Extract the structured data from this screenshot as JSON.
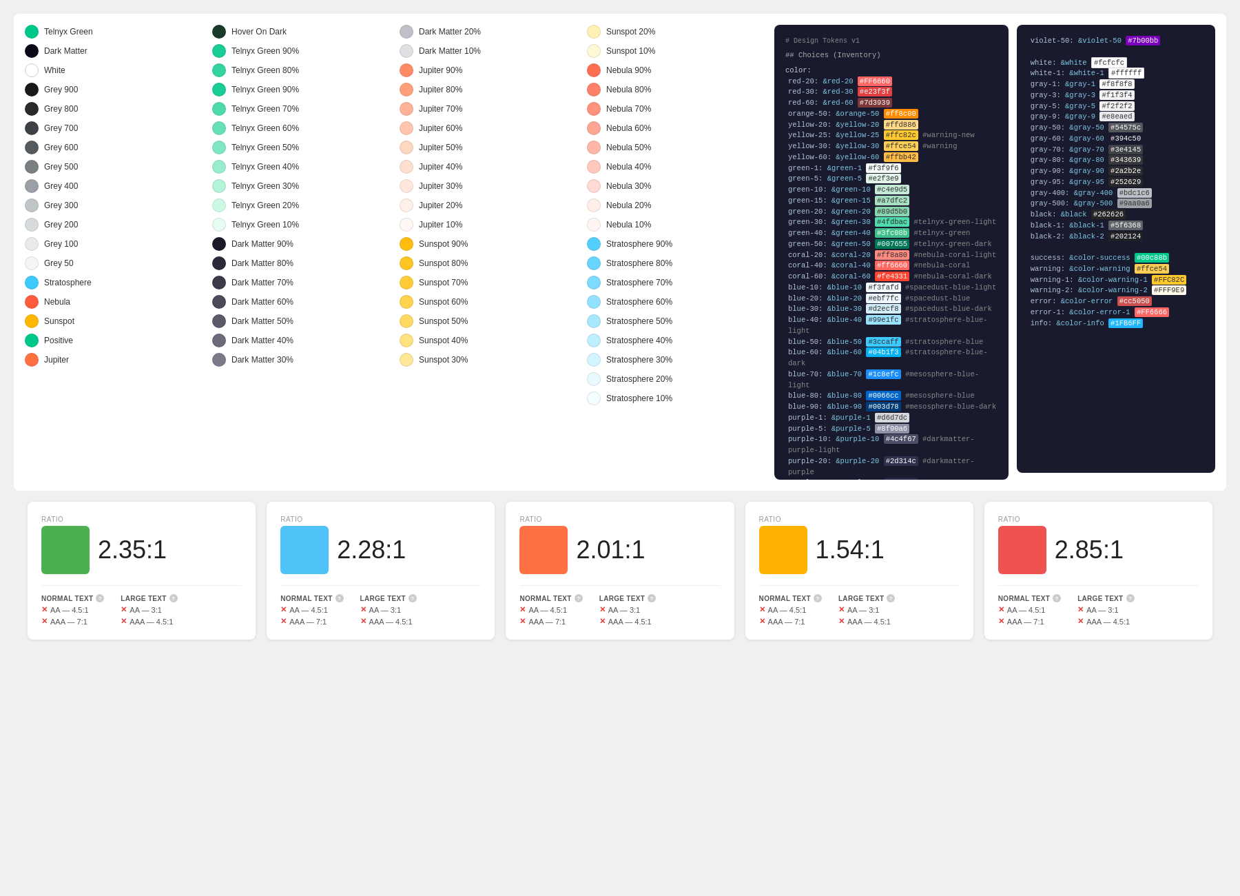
{
  "swatches": {
    "columns": [
      {
        "items": [
          {
            "label": "Telnyx Green",
            "color": "#00c88b",
            "type": "filled"
          },
          {
            "label": "Dark Matter",
            "color": "#0a0a1a",
            "type": "filled"
          },
          {
            "label": "White",
            "color": "#ffffff",
            "type": "outline"
          },
          {
            "label": "Grey 900",
            "color": "#1a1a1a",
            "type": "filled"
          },
          {
            "label": "Grey 800",
            "color": "#2a2a2a",
            "type": "filled"
          },
          {
            "label": "Grey 700",
            "color": "#3e4145",
            "type": "filled"
          },
          {
            "label": "Grey 600",
            "color": "#555a5e",
            "type": "filled"
          },
          {
            "label": "Grey 500",
            "color": "#7a8082",
            "type": "filled"
          },
          {
            "label": "Grey 400",
            "color": "#9aa0a6",
            "type": "filled"
          },
          {
            "label": "Grey 300",
            "color": "#c0c5c8",
            "type": "filled"
          },
          {
            "label": "Grey 200",
            "color": "#d8dbdd",
            "type": "filled"
          },
          {
            "label": "Grey 100",
            "color": "#e8eaeb",
            "type": "filled"
          },
          {
            "label": "Grey 50",
            "color": "#f4f5f5",
            "type": "filled"
          },
          {
            "label": "Stratosphere",
            "color": "#3ccaff",
            "type": "filled"
          },
          {
            "label": "Nebula",
            "color": "#ff5c3d",
            "type": "filled"
          },
          {
            "label": "Sunspot",
            "color": "#ffb700",
            "type": "filled"
          },
          {
            "label": "Positive",
            "color": "#00c88b",
            "type": "filled"
          },
          {
            "label": "Jupiter",
            "color": "#ff7043",
            "type": "filled"
          }
        ]
      },
      {
        "items": [
          {
            "label": "Hover On Dark",
            "color": "#1a3a2a",
            "type": "filled"
          },
          {
            "label": "Telnyx Green 90%",
            "color": "#1acd96",
            "type": "filled"
          },
          {
            "label": "Telnyx Green 80%",
            "color": "#33d3a1",
            "type": "filled"
          },
          {
            "label": "Telnyx Green 90%",
            "color": "#1acd96",
            "type": "filled"
          },
          {
            "label": "Telnyx Green 70%",
            "color": "#4ddaac",
            "type": "filled"
          },
          {
            "label": "Telnyx Green 60%",
            "color": "#66e0b7",
            "type": "filled"
          },
          {
            "label": "Telnyx Green 50%",
            "color": "#80e7c2",
            "type": "filled"
          },
          {
            "label": "Telnyx Green 40%",
            "color": "#99edcd",
            "type": "filled"
          },
          {
            "label": "Telnyx Green 30%",
            "color": "#b3f3d8",
            "type": "filled"
          },
          {
            "label": "Telnyx Green 20%",
            "color": "#ccf9e3",
            "type": "filled"
          },
          {
            "label": "Telnyx Green 10%",
            "color": "#e6fcf1",
            "type": "filled"
          },
          {
            "label": "Dark Matter 90%",
            "color": "#1a1a2a",
            "type": "filled"
          },
          {
            "label": "Dark Matter 80%",
            "color": "#2a2a3a",
            "type": "filled"
          },
          {
            "label": "Dark Matter 70%",
            "color": "#3a3a4a",
            "type": "filled"
          },
          {
            "label": "Dark Matter 60%",
            "color": "#4a4a5a",
            "type": "filled"
          },
          {
            "label": "Dark Matter 50%",
            "color": "#5a5a6a",
            "type": "filled"
          },
          {
            "label": "Dark Matter 40%",
            "color": "#6a6a7a",
            "type": "filled"
          },
          {
            "label": "Dark Matter 30%",
            "color": "#7a7a8a",
            "type": "filled"
          }
        ]
      },
      {
        "items": [
          {
            "label": "Dark Matter 20%",
            "color": "#c0c0c8",
            "type": "filled"
          },
          {
            "label": "Dark Matter 10%",
            "color": "#e0e0e4",
            "type": "filled"
          },
          {
            "label": "Jupiter 90%",
            "color": "#ff8a65",
            "type": "filled"
          },
          {
            "label": "Jupiter 80%",
            "color": "#ffa07a",
            "type": "filled"
          },
          {
            "label": "Jupiter 70%",
            "color": "#ffb399",
            "type": "filled"
          },
          {
            "label": "Jupiter 60%",
            "color": "#ffc5ad",
            "type": "filled"
          },
          {
            "label": "Jupiter 50%",
            "color": "#ffd8c2",
            "type": "filled"
          },
          {
            "label": "Jupiter 40%",
            "color": "#ffe0d0",
            "type": "filled"
          },
          {
            "label": "Jupiter 30%",
            "color": "#ffe8db",
            "type": "filled"
          },
          {
            "label": "Jupiter 20%",
            "color": "#fff0e8",
            "type": "filled"
          },
          {
            "label": "Jupiter 10%",
            "color": "#fff8f4",
            "type": "filled"
          },
          {
            "label": "Sunspot 90%",
            "color": "#ffbe0f",
            "type": "filled"
          },
          {
            "label": "Sunspot 80%",
            "color": "#ffc523",
            "type": "filled"
          },
          {
            "label": "Sunspot 70%",
            "color": "#ffcc38",
            "type": "filled"
          },
          {
            "label": "Sunspot 60%",
            "color": "#ffd34d",
            "type": "filled"
          },
          {
            "label": "Sunspot 50%",
            "color": "#ffda62",
            "type": "filled"
          },
          {
            "label": "Sunspot 40%",
            "color": "#ffe180",
            "type": "filled"
          },
          {
            "label": "Sunspot 30%",
            "color": "#ffe89a",
            "type": "filled"
          }
        ]
      },
      {
        "items": [
          {
            "label": "Sunspot 20%",
            "color": "#fff0b3",
            "type": "filled"
          },
          {
            "label": "Sunspot 10%",
            "color": "#fff8d6",
            "type": "filled"
          },
          {
            "label": "Nebula 90%",
            "color": "#ff6e52",
            "type": "filled"
          },
          {
            "label": "Nebula 80%",
            "color": "#ff8068",
            "type": "filled"
          },
          {
            "label": "Nebula 70%",
            "color": "#ff927d",
            "type": "filled"
          },
          {
            "label": "Nebula 60%",
            "color": "#ffa593",
            "type": "filled"
          },
          {
            "label": "Nebula 50%",
            "color": "#ffb7a8",
            "type": "filled"
          },
          {
            "label": "Nebula 40%",
            "color": "#ffc9be",
            "type": "filled"
          },
          {
            "label": "Nebula 30%",
            "color": "#ffdbd3",
            "type": "filled"
          },
          {
            "label": "Nebula 20%",
            "color": "#ffede8",
            "type": "filled"
          },
          {
            "label": "Nebula 10%",
            "color": "#fff6f4",
            "type": "filled"
          },
          {
            "label": "Stratosphere 90%",
            "color": "#52cfff",
            "type": "filled"
          },
          {
            "label": "Stratosphere 80%",
            "color": "#67d5ff",
            "type": "filled"
          },
          {
            "label": "Stratosphere 70%",
            "color": "#7ddbff",
            "type": "filled"
          },
          {
            "label": "Stratosphere 60%",
            "color": "#93e1ff",
            "type": "filled"
          },
          {
            "label": "Stratosphere 50%",
            "color": "#a8e8ff",
            "type": "filled"
          },
          {
            "label": "Stratosphere 40%",
            "color": "#beefff",
            "type": "filled"
          },
          {
            "label": "Stratosphere 30%",
            "color": "#d3f5ff",
            "type": "filled"
          },
          {
            "label": "Stratosphere 20%",
            "color": "#e9faff",
            "type": "filled"
          },
          {
            "label": "Stratosphere 10%",
            "color": "#f4fdff",
            "type": "filled"
          }
        ]
      }
    ]
  },
  "contrast_cards": [
    {
      "ratio": "2.35:1",
      "color": "#4CAF50",
      "normal_aa": false,
      "normal_aaa": false,
      "large_aa": false,
      "large_aaa": false
    },
    {
      "ratio": "2.28:1",
      "color": "#4fc3f7",
      "normal_aa": false,
      "normal_aaa": false,
      "large_aa": false,
      "large_aaa": false
    },
    {
      "ratio": "2.01:1",
      "color": "#ff7043",
      "normal_aa": false,
      "normal_aaa": false,
      "large_aa": false,
      "large_aaa": false
    },
    {
      "ratio": "1.54:1",
      "color": "#ffb300",
      "normal_aa": false,
      "normal_aaa": false,
      "large_aa": false,
      "large_aaa": false
    },
    {
      "ratio": "2.85:1",
      "color": "#ef5350",
      "normal_aa": false,
      "normal_aaa": false,
      "large_aa": false,
      "large_aaa": false
    }
  ],
  "labels": {
    "ratio": "RATIO",
    "normal_text": "NORMAL TEXT",
    "large_text": "LARGE TEXT",
    "aa_45": "AA — 4.5:1",
    "aaa_7": "AAA — 7:1",
    "aa_3": "AA — 3:1",
    "aaa_45": "AAA — 4.5:1"
  }
}
